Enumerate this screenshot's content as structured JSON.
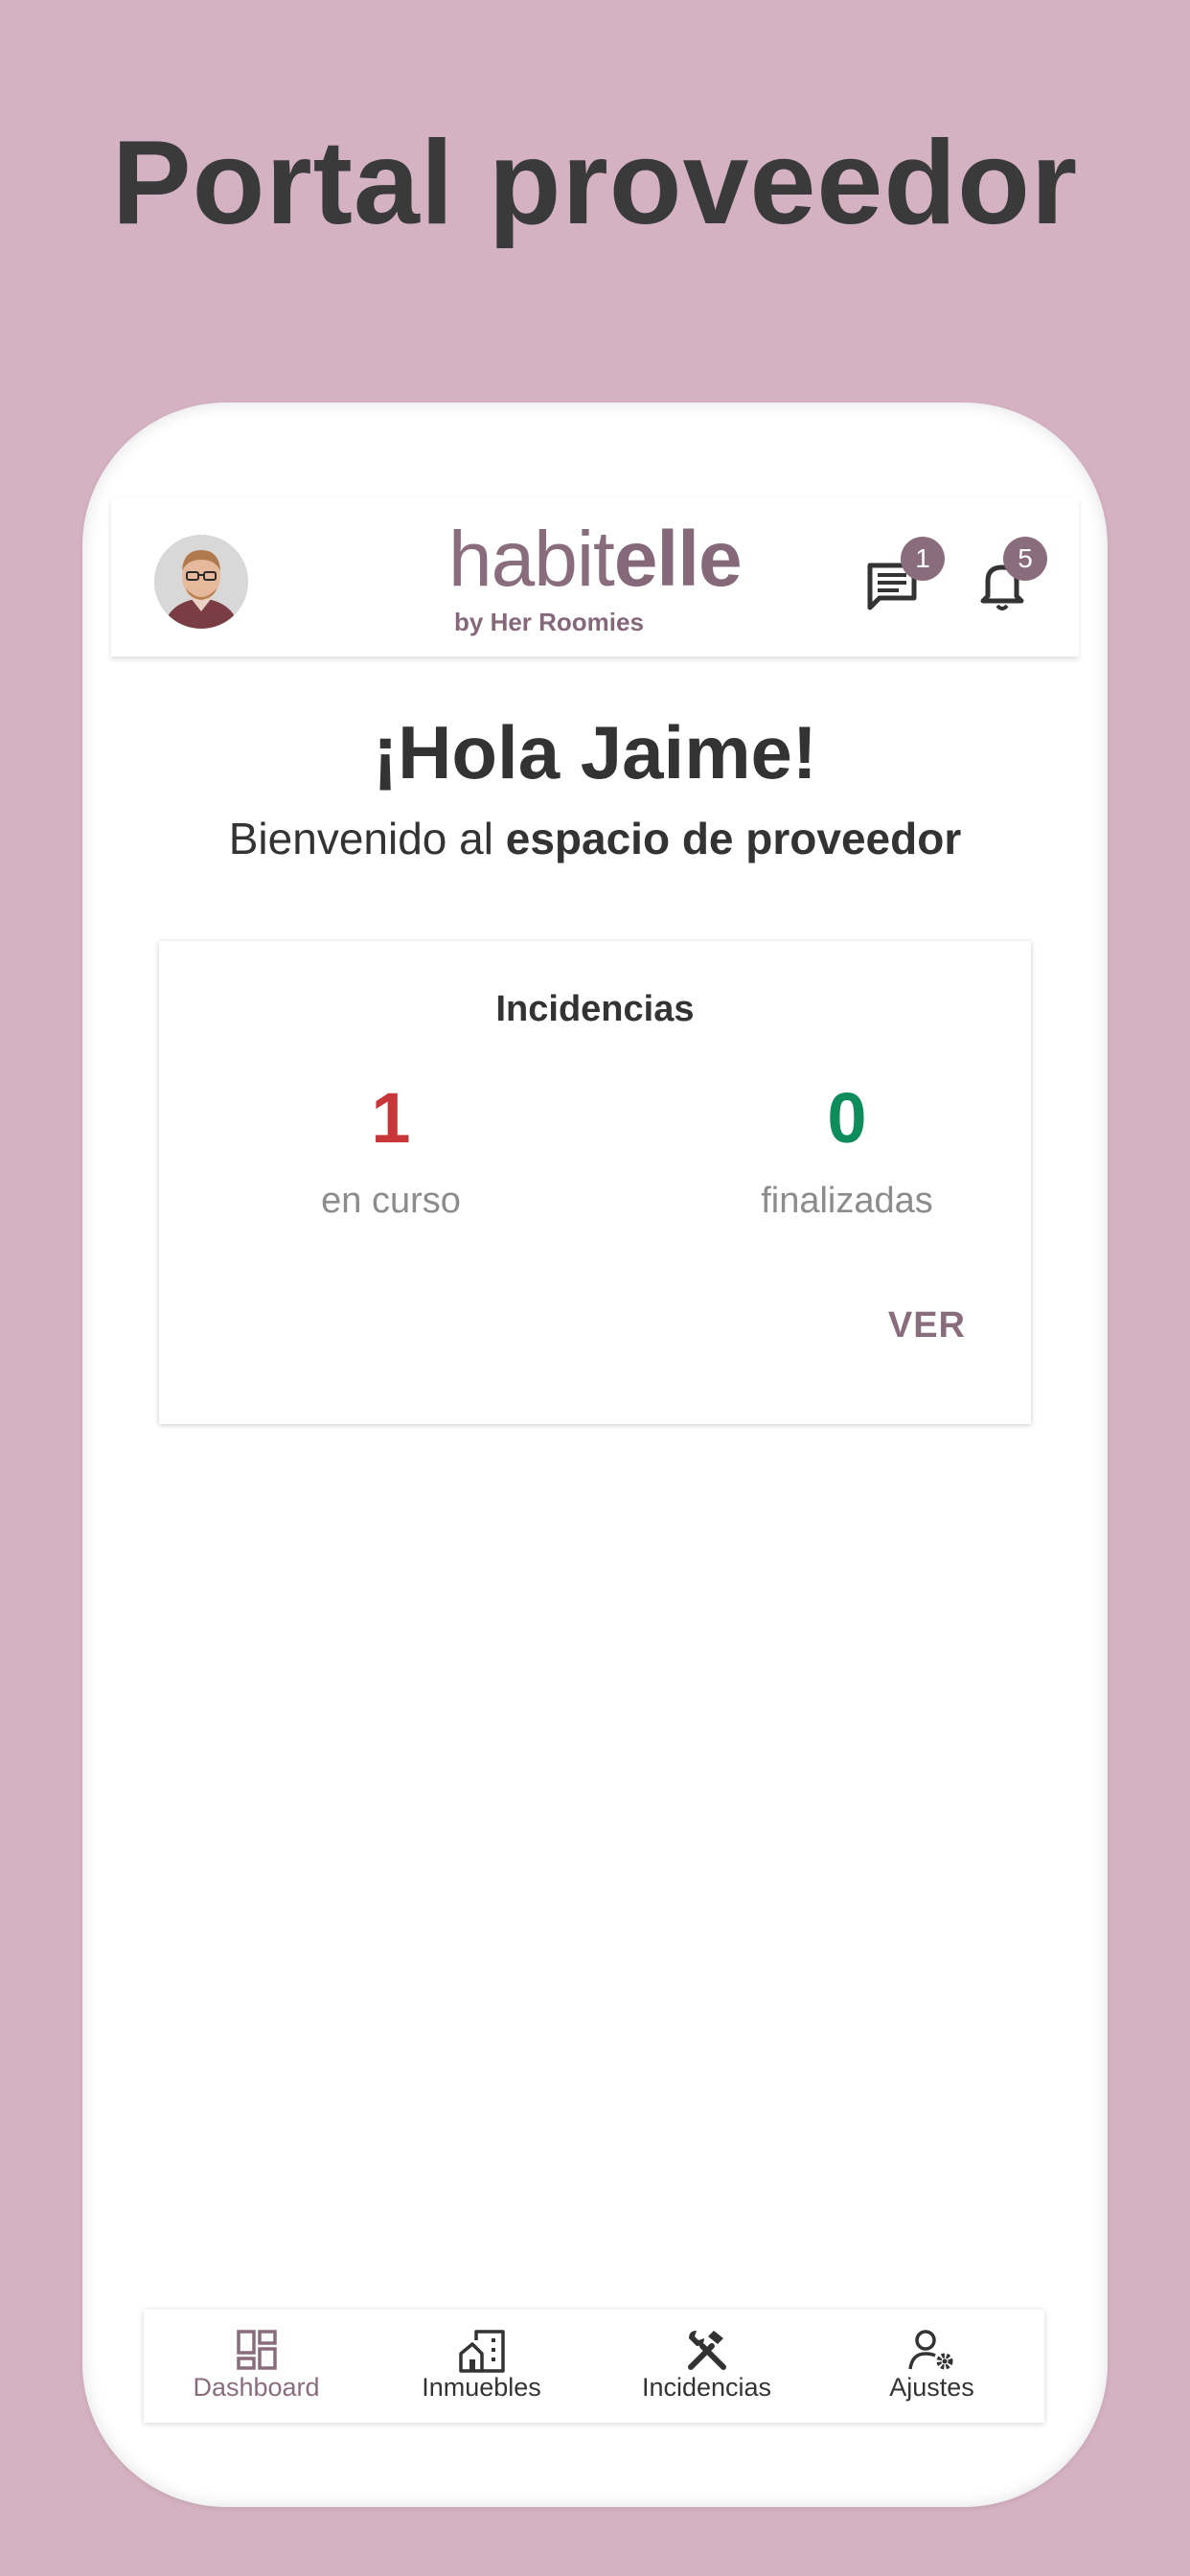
{
  "banner": {
    "title": "Portal proveedor"
  },
  "header": {
    "logo_text_light": "habit",
    "logo_text_bold": "elle",
    "logo_subtext": "by Her Roomies",
    "messages_badge": "1",
    "notifications_badge": "5"
  },
  "welcome": {
    "greeting": "¡Hola Jaime!",
    "subtitle_prefix": "Bienvenido al ",
    "subtitle_bold": "espacio de proveedor"
  },
  "incidents_card": {
    "title": "Incidencias",
    "in_progress_count": "1",
    "in_progress_label": "en curso",
    "finished_count": "0",
    "finished_label": "finalizadas",
    "view_label": "VER"
  },
  "bottom_nav": {
    "items": [
      {
        "label": "Dashboard",
        "icon": "dashboard-icon",
        "active": true
      },
      {
        "label": "Inmuebles",
        "icon": "building-icon",
        "active": false
      },
      {
        "label": "Incidencias",
        "icon": "tools-icon",
        "active": false
      },
      {
        "label": "Ajustes",
        "icon": "user-settings-icon",
        "active": false
      }
    ]
  },
  "colors": {
    "background": "#d5b2c1",
    "accent": "#8a6d7d",
    "in_progress": "#c8363a",
    "finished": "#0e8c5c"
  }
}
